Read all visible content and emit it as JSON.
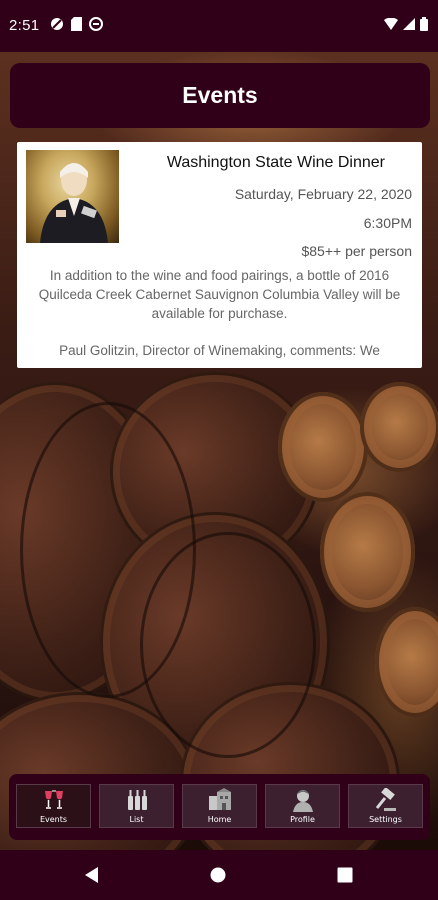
{
  "status_bar": {
    "time": "2:51"
  },
  "header": {
    "title": "Events"
  },
  "event": {
    "title": "Washington State Wine Dinner",
    "date": "Saturday, February 22, 2020",
    "time": "6:30PM",
    "price": "$85++ per person",
    "description": "In addition to the wine and food pairings, a bottle of 2016 Quilceda Creek Cabernet Sauvignon Columbia Valley will be available for purchase.",
    "comment": "Paul Golitzin, Director of Winemaking, comments: We"
  },
  "bottom_nav": {
    "items": [
      {
        "label": "Events",
        "icon": "wine-glasses-icon",
        "active": true
      },
      {
        "label": "List",
        "icon": "wine-bottles-icon",
        "active": false
      },
      {
        "label": "Home",
        "icon": "winery-building-icon",
        "active": false
      },
      {
        "label": "Profile",
        "icon": "person-icon",
        "active": false
      },
      {
        "label": "Settings",
        "icon": "gavel-icon",
        "active": false
      }
    ]
  },
  "colors": {
    "primary": "#300018",
    "card_bg": "#ffffff",
    "text_dark": "#111111",
    "text_muted": "#555555"
  }
}
